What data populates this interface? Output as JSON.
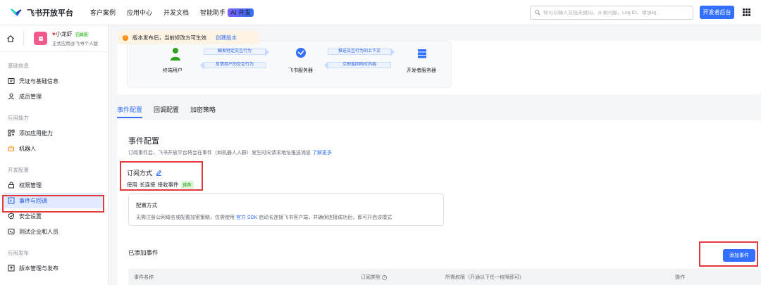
{
  "topnav": {
    "brand": "飞书开放平台",
    "links": [
      "客户案例",
      "应用中心",
      "开发文档",
      "智能助手"
    ],
    "ai_badge": "AI 开发",
    "search_placeholder": "你可以输入文档关键词、开发问题、Log ID、错误码",
    "dev_console": "开发者后台"
  },
  "app": {
    "name": "小龙虾",
    "status": "已启用",
    "subtitle": "正式应用@飞书个人版"
  },
  "sidebar": {
    "sections": [
      {
        "title": "基础信息",
        "items": [
          {
            "label": "凭证与基础信息",
            "icon": "credential-icon"
          },
          {
            "label": "成员管理",
            "icon": "member-icon"
          }
        ]
      },
      {
        "title": "应用能力",
        "items": [
          {
            "label": "添加应用能力",
            "icon": "grid-icon"
          },
          {
            "label": "机器人",
            "icon": "robot-icon"
          }
        ]
      },
      {
        "title": "开发配置",
        "items": [
          {
            "label": "权限管理",
            "icon": "lock-icon"
          },
          {
            "label": "事件与回调",
            "icon": "event-icon",
            "active": true
          },
          {
            "label": "安全设置",
            "icon": "shield-icon"
          },
          {
            "label": "测试企业和人员",
            "icon": "test-icon"
          }
        ]
      },
      {
        "title": "应用发布",
        "items": [
          {
            "label": "版本管理与发布",
            "icon": "publish-icon"
          }
        ]
      }
    ]
  },
  "banner": {
    "text": "版本发布后，当前修改方可生效",
    "link": "创建版本"
  },
  "diagram": {
    "nodes": [
      "终端用户",
      "飞书服务器",
      "开发者服务器"
    ],
    "arrows": [
      "触发特定交互行为",
      "反馈用户的交互行为",
      "推送交互行为的上下文",
      "立即返回响应内容"
    ]
  },
  "tabs": [
    "事件配置",
    "回调配置",
    "加密策略"
  ],
  "event_config": {
    "title": "事件配置",
    "desc": "订阅事件后，飞书开放平台将会在事件（如机器人入群）发生时向请求地址推送消息",
    "learn_more": "了解更多",
    "sub_title": "订阅方式",
    "sub_prefix": "使用",
    "sub_method": "长连接",
    "sub_suffix": "接收事件",
    "recommend": "推荐",
    "cfg_title": "配置方式",
    "cfg_desc_1": "无需注册公网域名或配置加密策略，仅需使用",
    "cfg_sdk": "官方 SDK",
    "cfg_desc_2": "启动长连接飞书客户端，并确保连接成功后，即可开启该模式",
    "added_title": "已添加事件",
    "add_button": "添加事件",
    "columns": [
      "事件名称",
      "订阅类型",
      "所需权限（开通以下任一权限即可）",
      "操作"
    ]
  },
  "colors": {
    "accent": "#3370ff",
    "highlight_box": "#e4393c"
  }
}
